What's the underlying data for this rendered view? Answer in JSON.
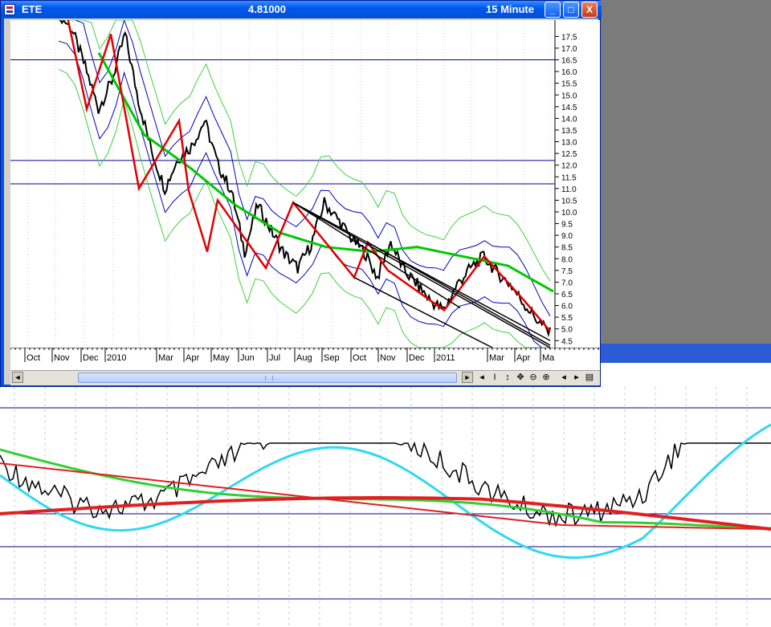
{
  "window": {
    "symbol": "ETE",
    "price": "4.81000",
    "interval": "15 Minute",
    "buttons": {
      "minimize": "_",
      "maximize": "□",
      "close": "X"
    }
  },
  "chart_data": [
    {
      "type": "line",
      "title": "ETE",
      "yticks": [
        "17.5",
        "17.0",
        "16.5",
        "16.0",
        "15.5",
        "15.0",
        "14.5",
        "14.0",
        "13.5",
        "13.0",
        "12.5",
        "12.0",
        "11.5",
        "11.0",
        "10.5",
        "10.0",
        "9.5",
        "9.0",
        "8.5",
        "8.0",
        "7.5",
        "7.0",
        "6.5",
        "6.0",
        "5.5",
        "5.0",
        "4.5"
      ],
      "ylim": [
        4.2,
        18.2
      ],
      "xticks": [
        "Oct",
        "Nov",
        "Dec",
        "2010",
        "Mar",
        "Apr",
        "May",
        "Jun",
        "Jul",
        "Aug",
        "Sep",
        "Oct",
        "Nov",
        "Dec",
        "2011",
        "Mar",
        "Apr",
        "Ma"
      ],
      "series": [
        {
          "values": [
            18.5,
            17.8,
            16.2,
            14.4,
            15.6,
            17.6,
            14.8,
            12.6,
            11.0,
            12.3,
            12.8,
            13.9,
            12.0,
            10.9,
            8.3,
            10.3,
            9.2,
            8.2,
            7.6,
            8.6,
            10.4,
            9.7,
            8.9,
            8.3,
            7.2,
            8.7,
            7.5,
            6.9,
            6.2,
            5.8,
            6.9,
            7.6,
            8.1,
            7.4,
            6.9,
            6.1,
            5.4,
            4.8
          ],
          "color": "#000000"
        },
        {
          "values": [
            16.8,
            13.3,
            11.9,
            10.3,
            9.1,
            8.5,
            8.3,
            8.5,
            8.1,
            7.7,
            6.6
          ],
          "color": "#00c800"
        }
      ],
      "hlines": [
        16.5,
        12.2,
        11.2
      ]
    }
  ],
  "scroll_tools": [
    "◂",
    "I",
    "↕",
    "✥",
    "⊖",
    "⊕",
    "◂",
    "▸",
    "▤"
  ]
}
